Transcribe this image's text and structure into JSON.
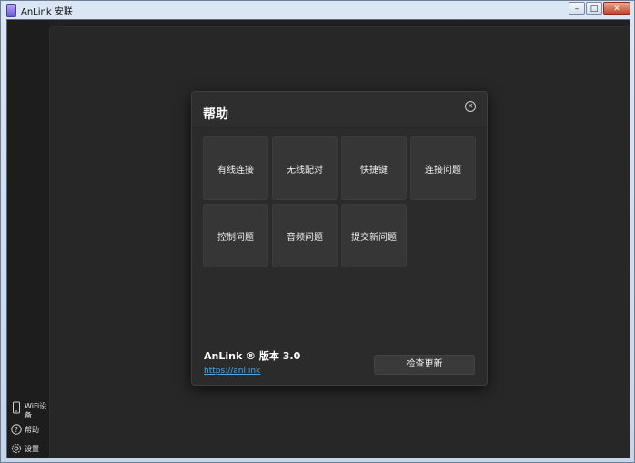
{
  "window": {
    "title": "AnLink 安联",
    "controls": {
      "minimize": "–",
      "maximize": "□",
      "close": "✕"
    }
  },
  "sidebar": {
    "items": [
      {
        "icon": "phone-icon",
        "label": "WiFi设备"
      },
      {
        "icon": "help-icon",
        "label": "帮助"
      },
      {
        "icon": "gear-icon",
        "label": "设置"
      }
    ]
  },
  "dialog": {
    "title": "帮助",
    "close_glyph": "✕",
    "tiles": [
      "有线连接",
      "无线配对",
      "快捷键",
      "连接问题",
      "控制问题",
      "音频问题",
      "提交新问题"
    ],
    "version_text": "AnLink ® 版本 3.0",
    "link_text": "https://anl.ink",
    "update_button": "检查更新"
  }
}
